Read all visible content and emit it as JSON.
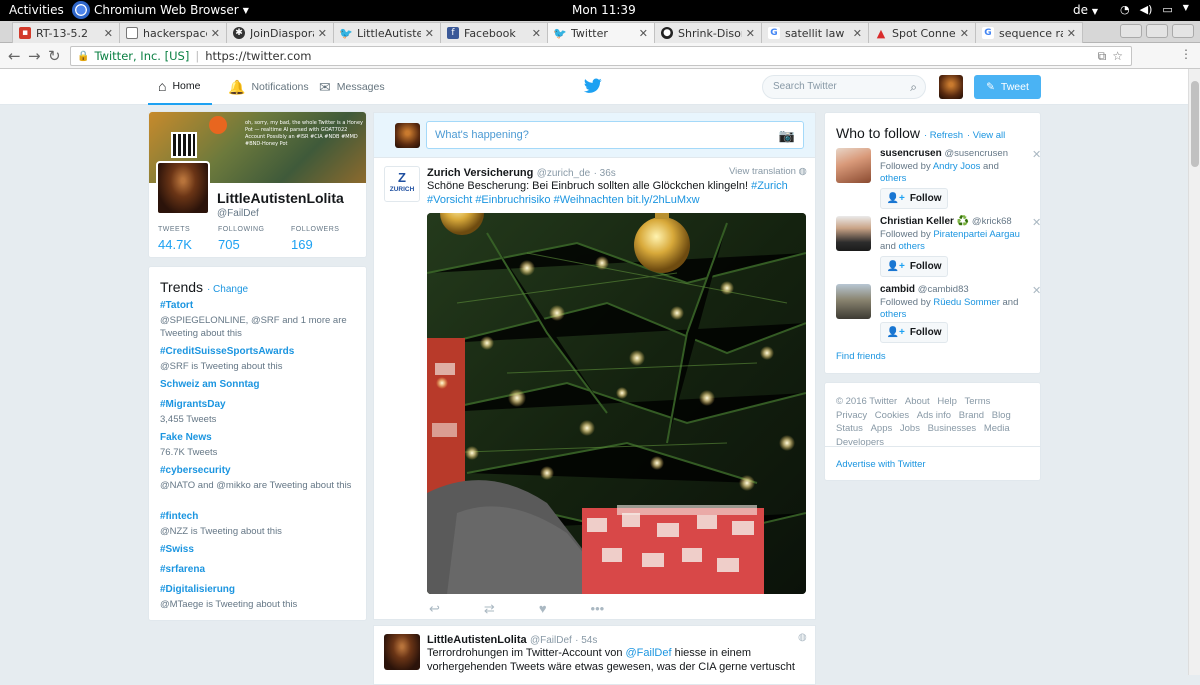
{
  "system": {
    "activities": "Activities",
    "app_name": "Chromium Web Browser",
    "clock": "Mon 11:39",
    "lang": "de"
  },
  "tabs": [
    {
      "label": "RT-13-5.2",
      "color": "#d23a2b"
    },
    {
      "label": "hackerspace",
      "color": "#777777"
    },
    {
      "label": "JoinDiaspora",
      "color": "#333333"
    },
    {
      "label": "LittleAutiste",
      "color": "#1da1f2"
    },
    {
      "label": "Facebook",
      "color": "#3b5998"
    },
    {
      "label": "Twitter",
      "color": "#1da1f2"
    },
    {
      "label": "Shrink-Disor",
      "color": "#222222"
    },
    {
      "label": "satellit law",
      "color": "#4285f4"
    },
    {
      "label": "Spot Conne",
      "color": "#d92b2b"
    },
    {
      "label": "sequence ra",
      "color": "#4285f4"
    }
  ],
  "address": {
    "org": "Twitter, Inc. [US]",
    "url": "https://twitter.com"
  },
  "nav": {
    "home": "Home",
    "notifications": "Notifications",
    "messages": "Messages",
    "search_placeholder": "Search Twitter",
    "tweet_button": "Tweet"
  },
  "profile": {
    "name": "LittleAutistenLolita",
    "handle": "@FailDef",
    "banner_text": "oh, sorry, my bad, the whole Twitter is a Honey Pot — realtime AI parsed with GOAT7022 Account Possibly an #ISR #CIA #NDB #MMD #BND-Honey Pot",
    "stats": [
      {
        "label": "TWEETS",
        "value": "44.7K"
      },
      {
        "label": "FOLLOWING",
        "value": "705"
      },
      {
        "label": "FOLLOWERS",
        "value": "169"
      }
    ]
  },
  "trends": {
    "title": "Trends",
    "change": "· Change",
    "items": [
      {
        "name": "#Tatort",
        "sub": "@SPIEGELONLINE, @SRF and 1 more are Tweeting about this"
      },
      {
        "name": "#CreditSuisseSportsAwards",
        "sub": "@SRF is Tweeting about this"
      },
      {
        "name": "Schweiz am Sonntag",
        "sub": ""
      },
      {
        "name": "#MigrantsDay",
        "sub": "3,455 Tweets"
      },
      {
        "name": "Fake News",
        "sub": "76.7K Tweets"
      },
      {
        "name": "#cybersecurity",
        "sub": "@NATO and @mikko are Tweeting about this"
      },
      {
        "name": "#fintech",
        "sub": "@NZZ is Tweeting about this"
      },
      {
        "name": "#Swiss",
        "sub": ""
      },
      {
        "name": "#srfarena",
        "sub": ""
      },
      {
        "name": "#Digitalisierung",
        "sub": "@MTaege is Tweeting about this"
      }
    ]
  },
  "composer": {
    "placeholder": "What's happening?"
  },
  "tweet1": {
    "name": "Zurich Versicherung",
    "handle": "@zurich_de",
    "time": "· 36s",
    "view_translation": "View translation",
    "logo_letter": "Z",
    "logo_word": "ZURICH",
    "text_plain": "Schöne Bescherung: Bei Einbruch sollten alle Glöckchen klingeln!",
    "hashtag1": "#Zurich",
    "hashtag2": "#Vorsicht",
    "hashtag3": "#Einbruchrisiko",
    "hashtag4": "#Weihnachten",
    "link": "bit.ly/2hLuMxw"
  },
  "tweet2": {
    "name": "LittleAutistenLolita",
    "handle": "@FailDef",
    "time": "· 54s",
    "text_a": "Terrordrohungen im Twitter-Account von",
    "mention": "@FailDef",
    "text_b": "hiesse in einem vorhergehenden Tweets wäre etwas gewesen, was der CIA gerne vertuscht"
  },
  "who_to_follow": {
    "title": "Who to follow",
    "refresh": "· Refresh",
    "view_all": "· View all",
    "follow_label": "Follow",
    "find_friends": "Find friends",
    "followed_by": "Followed by",
    "and": "and",
    "others": "others",
    "suggestions": [
      {
        "name": "susencrusen",
        "handle": "@susencrusen",
        "by": "Andry Joos"
      },
      {
        "name": "Christian Keller ♻️",
        "handle": "@krick68",
        "by": "Piratenpartei Aargau"
      },
      {
        "name": "cambid",
        "handle": "@cambid83",
        "by": "Rüedu Sommer"
      }
    ]
  },
  "footer": {
    "links": [
      "© 2016 Twitter",
      "About",
      "Help",
      "Terms",
      "Privacy",
      "Cookies",
      "Ads info",
      "Brand",
      "Blog",
      "Status",
      "Apps",
      "Jobs",
      "Businesses",
      "Media",
      "Developers"
    ],
    "advertise": "Advertise with Twitter"
  },
  "colors": {
    "accent": "#1da1f2",
    "link": "#1b95e0",
    "background": "#e6ecf0"
  }
}
